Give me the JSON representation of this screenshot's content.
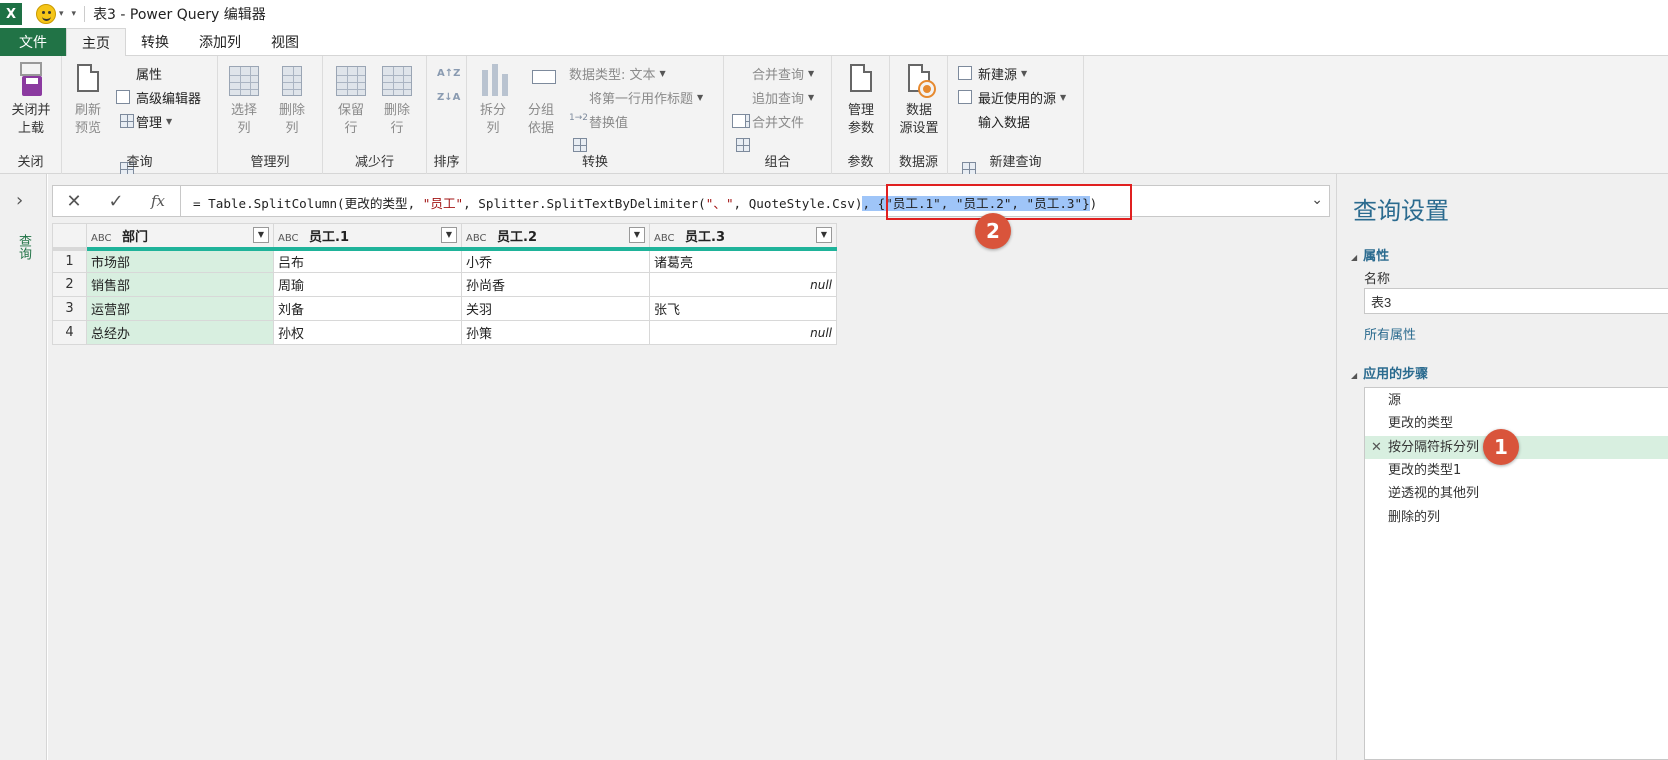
{
  "titlebar": {
    "app_logo": "X",
    "title": "表3 - Power Query 编辑器",
    "qat_icons": [
      "excel-logo-icon",
      "smiley-icon",
      "customize-qat-icon"
    ]
  },
  "tabs": [
    "文件",
    "主页",
    "转换",
    "添加列",
    "视图"
  ],
  "ribbon": {
    "close": {
      "button": "关闭并\n上载",
      "group": "关闭"
    },
    "query": {
      "refresh": "刷新\n预览",
      "properties": "属性",
      "advanced_editor": "高级编辑器",
      "manage": "管理",
      "group": "查询"
    },
    "manage_columns": {
      "choose": "选择\n列",
      "remove": "删除\n列",
      "group": "管理列"
    },
    "reduce_rows": {
      "keep": "保留\n行",
      "remove": "删除\n行",
      "group": "减少行"
    },
    "sort": {
      "group": "排序",
      "asc": "A↑Z",
      "desc": "Z↓A"
    },
    "transform": {
      "split": "拆分\n列",
      "group_by": "分组\n依据",
      "data_type": "数据类型: 文本",
      "first_row_header": "将第一行用作标题",
      "replace": "替换值",
      "group": "转换"
    },
    "combine": {
      "merge": "合并查询",
      "append": "追加查询",
      "merge_files": "合并文件",
      "group": "组合"
    },
    "params": {
      "manage": "管理\n参数",
      "group": "参数"
    },
    "datasource": {
      "settings": "数据\n源设置",
      "group": "数据源"
    },
    "newquery": {
      "new_source": "新建源",
      "recent": "最近使用的源",
      "enter_data": "输入数据",
      "group": "新建查询"
    }
  },
  "leftpane": {
    "label": "查询"
  },
  "formula": {
    "cancel": "✕",
    "commit": "✓",
    "fx": "fx",
    "p1": "= Table.SplitColumn(更改的类型, ",
    "s1": "\"员工\"",
    "p2": ", Splitter.SplitTextByDelimiter(",
    "s2": "\"、\"",
    "p3": ", QuoteStyle.Csv)",
    "sel": ", {\"员工.1\", \"员工.2\", \"员工.3\"}",
    "p4": ")"
  },
  "table": {
    "type_icon": "ABC",
    "headers": [
      "部门",
      "员工.1",
      "员工.2",
      "员工.3"
    ],
    "rows": [
      {
        "n": "1",
        "c": [
          "市场部",
          "吕布",
          "小乔",
          "诸葛亮"
        ]
      },
      {
        "n": "2",
        "c": [
          "销售部",
          "周瑜",
          "孙尚香",
          "null"
        ]
      },
      {
        "n": "3",
        "c": [
          "运营部",
          "刘备",
          "关羽",
          "张飞"
        ]
      },
      {
        "n": "4",
        "c": [
          "总经办",
          "孙权",
          "孙策",
          "null"
        ]
      }
    ]
  },
  "annotations": {
    "b1": "1",
    "b2": "2",
    "color": "#d9543b"
  },
  "settings": {
    "title": "查询设置",
    "properties": "属性",
    "name_label": "名称",
    "name_value": "表3",
    "all_props": "所有属性",
    "steps_title": "应用的步骤",
    "steps": [
      "源",
      "更改的类型",
      "按分隔符拆分列",
      "更改的类型1",
      "逆透视的其他列",
      "删除的列"
    ]
  },
  "colors": {
    "excel_green": "#217346",
    "accent_teal": "#1fb39a",
    "link_blue": "#2b6b8f",
    "highlight_red": "#e02020"
  }
}
